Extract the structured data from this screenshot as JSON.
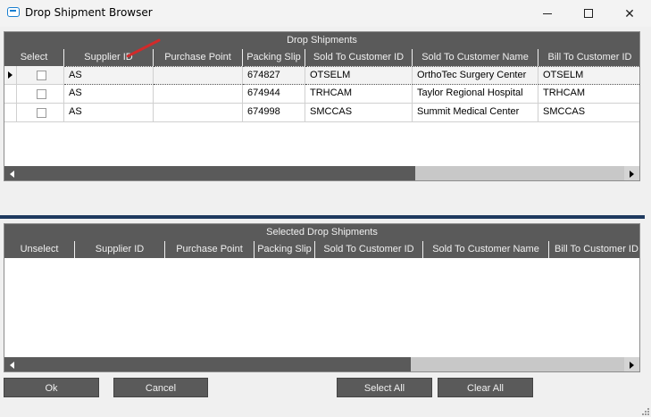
{
  "window": {
    "title": "Drop Shipment Browser"
  },
  "drop_shipments": {
    "caption": "Drop Shipments",
    "columns": [
      "Select",
      "Supplier ID",
      "Purchase Point",
      "Packing Slip",
      "Sold To Customer ID",
      "Sold To Customer Name",
      "Bill To Customer ID"
    ],
    "rows": [
      {
        "selected": false,
        "supplier_id": "AS",
        "purchase_point": "",
        "packing_slip": "674827",
        "sold_to_customer_id": "OTSELM",
        "sold_to_customer_name": "OrthoTec Surgery Center",
        "bill_to_customer_id": "OTSELM"
      },
      {
        "selected": false,
        "supplier_id": "AS",
        "purchase_point": "",
        "packing_slip": "674944",
        "sold_to_customer_id": "TRHCAM",
        "sold_to_customer_name": "Taylor Regional Hospital",
        "bill_to_customer_id": "TRHCAM"
      },
      {
        "selected": false,
        "supplier_id": "AS",
        "purchase_point": "",
        "packing_slip": "674998",
        "sold_to_customer_id": "SMCCAS",
        "sold_to_customer_name": "Summit Medical Center",
        "bill_to_customer_id": "SMCCAS"
      }
    ]
  },
  "selected_drop_shipments": {
    "caption": "Selected Drop Shipments",
    "columns": [
      "Unselect",
      "Supplier ID",
      "Purchase Point",
      "Packing Slip",
      "Sold To Customer ID",
      "Sold To Customer Name",
      "Bill To Customer ID"
    ],
    "rows": []
  },
  "buttons": {
    "ok": "Ok",
    "cancel": "Cancel",
    "select_all": "Select All",
    "clear_all": "Clear All"
  },
  "colors": {
    "grid_header": "#5a5a5a",
    "separator": "#1e3a5f",
    "annotation": "#d22a2a"
  }
}
